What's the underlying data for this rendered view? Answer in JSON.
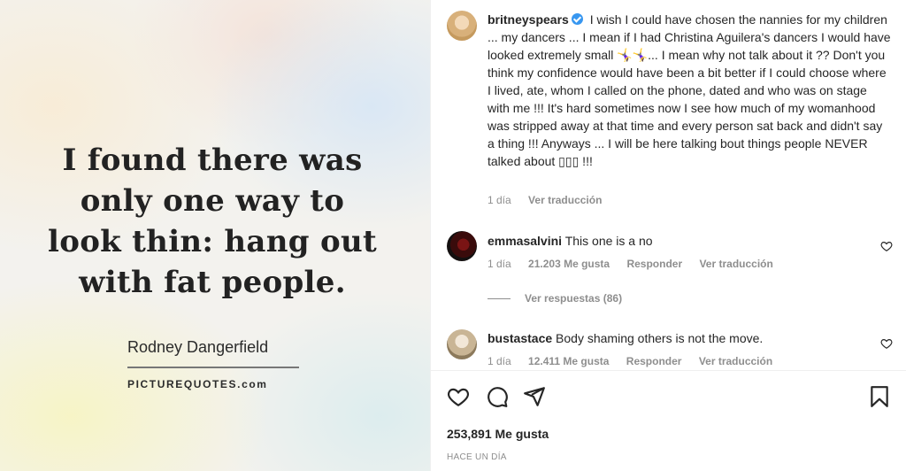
{
  "image": {
    "quote_lines": [
      "I found there was",
      "only one way to",
      "look thin: hang out",
      "with fat people."
    ],
    "author": "Rodney Dangerfield",
    "site": "PICTUREQUOTES.com"
  },
  "post": {
    "username": "britneyspears",
    "caption": "I wish I could have chosen the nannies for my children ... my dancers ... I mean if I had Christina Aguilera's dancers I would have looked extremely small 🤸‍♀️🤸‍♀️... I mean why not talk about it ?? Don't you think my confidence would have been a bit better if I could choose where I lived, ate, whom I called on the phone, dated and who was on stage with me !!! It's hard sometimes now I see how much of my womanhood was stripped away at that time and every person sat back and didn't say a thing !!! Anyways ... I will be here talking bout things people NEVER talked about ▯▯▯ !!!",
    "time": "1 día",
    "translate": "Ver traducción"
  },
  "comments": [
    {
      "username": "emmasalvini",
      "text": "This one is a no",
      "time": "1 día",
      "likes": "21.203 Me gusta",
      "reply": "Responder",
      "translate": "Ver traducción",
      "replies": "Ver respuestas (86)"
    },
    {
      "username": "bustastace",
      "text": "Body shaming others is not the move.",
      "time": "1 día",
      "likes": "12.411 Me gusta",
      "reply": "Responder",
      "translate": "Ver traducción"
    }
  ],
  "footer": {
    "likes": "253,891 Me gusta",
    "when": "HACE UN DÍA"
  },
  "icons": [
    "verified-icon",
    "heart-icon",
    "comment-icon",
    "share-icon",
    "bookmark-icon"
  ],
  "colors": {
    "verified": "#3897f0",
    "muted": "#8e8e8e",
    "text": "#262626"
  }
}
